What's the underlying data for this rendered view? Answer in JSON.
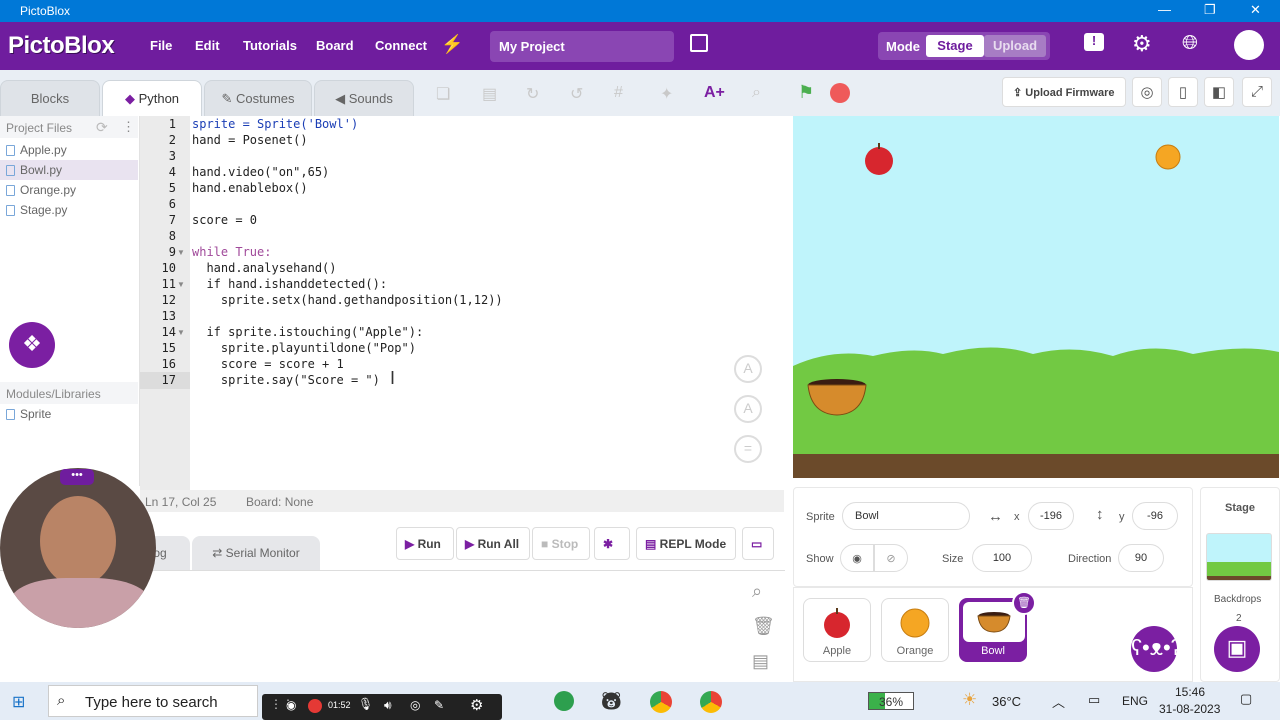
{
  "window": {
    "title": "PictoBlox"
  },
  "menubar": {
    "logo": "PictoBlox",
    "items": [
      "File",
      "Edit",
      "Tutorials",
      "Board",
      "Connect"
    ],
    "project_name": "My Project",
    "mode_label": "Mode",
    "stage_label": "Stage",
    "upload_label": "Upload"
  },
  "tabs": {
    "blocks": "Blocks",
    "python": "Python",
    "costumes": "Costumes",
    "sounds": "Sounds"
  },
  "stage_toolbar": {
    "upload_firmware": "Upload Firmware"
  },
  "files": {
    "header": "Project Files",
    "items": [
      "Apple.py",
      "Bowl.py",
      "Orange.py",
      "Stage.py"
    ],
    "selected": "Bowl.py"
  },
  "modules": {
    "header": "Modules/Libraries",
    "items": [
      "Sprite"
    ]
  },
  "code": {
    "line_numbers": [
      "1",
      "2",
      "3",
      "4",
      "5",
      "6",
      "7",
      "8",
      "9",
      "10",
      "11",
      "12",
      "13",
      "14",
      "15",
      "16",
      "17"
    ],
    "lines": [
      "sprite = Sprite('Bowl')",
      "hand = Posenet()",
      "",
      "hand.video(\"on\",65)",
      "hand.enablebox()",
      "",
      "score = 0",
      "",
      "while True:",
      "  hand.analysehand()",
      "  if hand.ishanddetected():",
      "    sprite.setx(hand.gethandposition(1,12))",
      "",
      "  if sprite.istouching(\"Apple\"):",
      "    sprite.playuntildone(\"Pop\")",
      "    score = score + 1",
      "    sprite.say(\"Score = \")"
    ]
  },
  "status": {
    "position": "Ln 17, Col 25",
    "board": "Board: None"
  },
  "bottom": {
    "log_tab": "og",
    "serial_tab": "Serial Monitor",
    "run": "Run",
    "run_all": "Run All",
    "stop": "Stop",
    "repl": "REPL Mode"
  },
  "sprite_panel": {
    "sprite_label": "Sprite",
    "sprite_name": "Bowl",
    "x_label": "x",
    "x_value": "-196",
    "y_label": "y",
    "y_value": "-96",
    "show_label": "Show",
    "size_label": "Size",
    "size_value": "100",
    "direction_label": "Direction",
    "direction_value": "90"
  },
  "sprites": [
    "Apple",
    "Orange",
    "Bowl"
  ],
  "selected_sprite": "Bowl",
  "stage_panel": {
    "title": "Stage",
    "backdrops_label": "Backdrops",
    "backdrops_count": "2"
  },
  "taskbar": {
    "search_placeholder": "Type here to search",
    "recording_time": "01:52",
    "battery": "36%",
    "temperature": "36°C",
    "language": "ENG",
    "time": "15:46",
    "date": "31-08-2023"
  },
  "colors": {
    "brand": "#6f1d9e",
    "accent": "#7b1fa2",
    "sky": "#bff4fb",
    "hills": "#72c943",
    "ground": "#6b4a2a"
  }
}
